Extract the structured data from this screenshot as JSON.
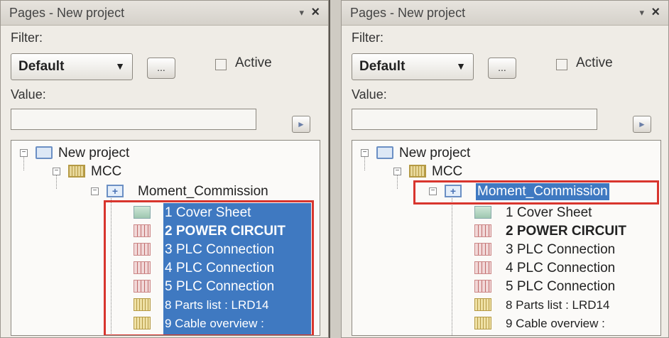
{
  "left_panel": {
    "title": "Pages - New project",
    "filter_label": "Filter:",
    "filter_value": "Default",
    "dots_label": "...",
    "active_label": "Active",
    "value_label": "Value:",
    "go_glyph": "►",
    "tree": {
      "project": "New project",
      "folder": "MCC",
      "structure": "Moment_Commission",
      "pages": [
        "1 Cover Sheet",
        "2 POWER CIRCUIT",
        "3 PLC Connection",
        "4 PLC Connection",
        "5 PLC Connection",
        "8 Parts list : LRD14",
        "9 Cable overview :"
      ]
    }
  },
  "right_panel": {
    "title": "Pages - New project",
    "filter_label": "Filter:",
    "filter_value": "Default",
    "dots_label": "...",
    "active_label": "Active",
    "value_label": "Value:",
    "go_glyph": "►",
    "tree": {
      "project": "New project",
      "folder": "MCC",
      "structure": "Moment_Commission",
      "pages": [
        "1 Cover Sheet",
        "2 POWER CIRCUIT",
        "3 PLC Connection",
        "4 PLC Connection",
        "5 PLC Connection",
        "8 Parts list : LRD14",
        "9 Cable overview :"
      ]
    }
  },
  "icons": {
    "pin": "▾",
    "close": "×",
    "collapse": "−",
    "dropdown": "▼"
  },
  "colors": {
    "selection": "#3f79c1",
    "highlight_box": "#d8352e"
  }
}
